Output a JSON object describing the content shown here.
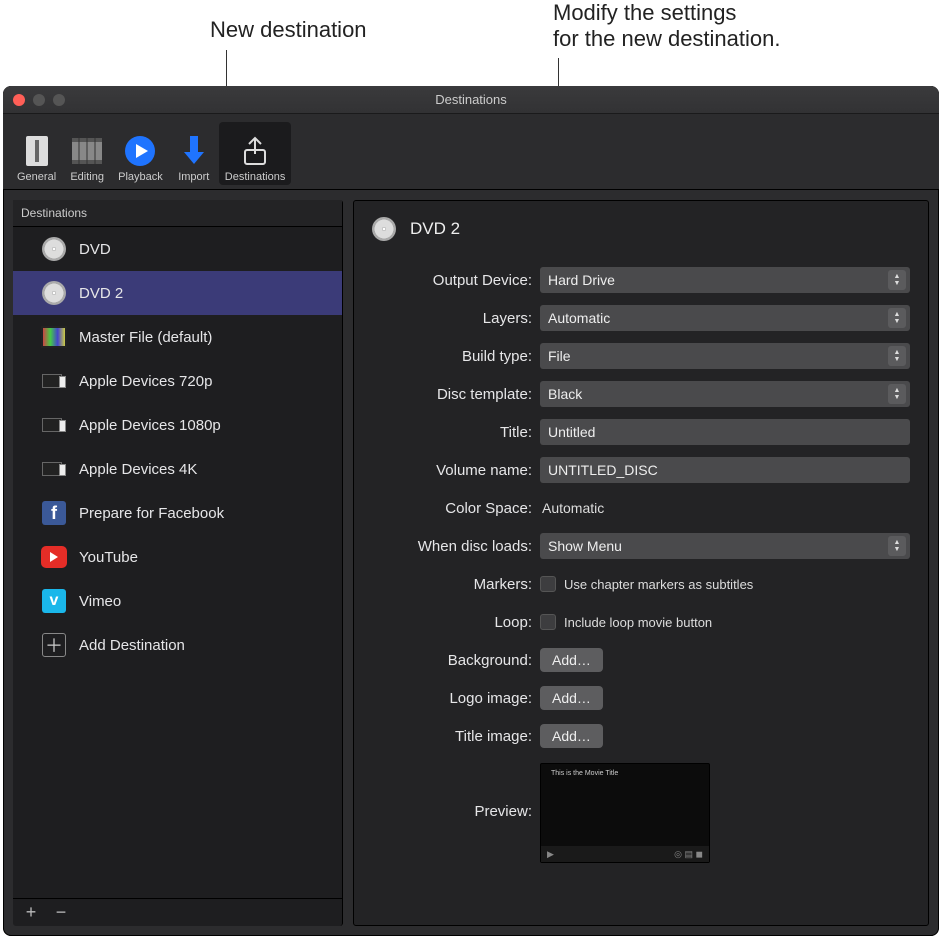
{
  "callouts": {
    "left": "New destination",
    "right_l1": "Modify the settings",
    "right_l2": "for the new destination."
  },
  "window": {
    "title": "Destinations"
  },
  "toolbar": {
    "items": [
      {
        "label": "General"
      },
      {
        "label": "Editing"
      },
      {
        "label": "Playback"
      },
      {
        "label": "Import"
      },
      {
        "label": "Destinations"
      }
    ]
  },
  "sidebar": {
    "header": "Destinations",
    "items": [
      {
        "label": "DVD",
        "icon": "disc"
      },
      {
        "label": "DVD 2",
        "icon": "disc",
        "selected": true
      },
      {
        "label": "Master File (default)",
        "icon": "film"
      },
      {
        "label": "Apple Devices 720p",
        "icon": "devices"
      },
      {
        "label": "Apple Devices 1080p",
        "icon": "devices"
      },
      {
        "label": "Apple Devices 4K",
        "icon": "devices"
      },
      {
        "label": "Prepare for Facebook",
        "icon": "facebook"
      },
      {
        "label": "YouTube",
        "icon": "youtube"
      },
      {
        "label": "Vimeo",
        "icon": "vimeo"
      },
      {
        "label": "Add Destination",
        "icon": "plusbox"
      }
    ],
    "footer": {
      "add": "+",
      "remove": "−"
    }
  },
  "detail": {
    "title": "DVD 2",
    "rows": {
      "output_device": {
        "label": "Output Device:",
        "value": "Hard Drive"
      },
      "layers": {
        "label": "Layers:",
        "value": "Automatic"
      },
      "build_type": {
        "label": "Build type:",
        "value": "File"
      },
      "disc_template": {
        "label": "Disc template:",
        "value": "Black"
      },
      "title_field": {
        "label": "Title:",
        "value": "Untitled"
      },
      "volume_name": {
        "label": "Volume name:",
        "value": "UNTITLED_DISC"
      },
      "color_space": {
        "label": "Color Space:",
        "value": "Automatic"
      },
      "when_loads": {
        "label": "When disc loads:",
        "value": "Show Menu"
      },
      "markers": {
        "label": "Markers:",
        "value": "Use chapter markers as subtitles"
      },
      "loop": {
        "label": "Loop:",
        "value": "Include loop movie button"
      },
      "background": {
        "label": "Background:",
        "value": "Add…"
      },
      "logo_image": {
        "label": "Logo image:",
        "value": "Add…"
      },
      "title_image": {
        "label": "Title image:",
        "value": "Add…"
      },
      "preview": {
        "label": "Preview:",
        "caption": "This is the Movie Title"
      }
    }
  }
}
